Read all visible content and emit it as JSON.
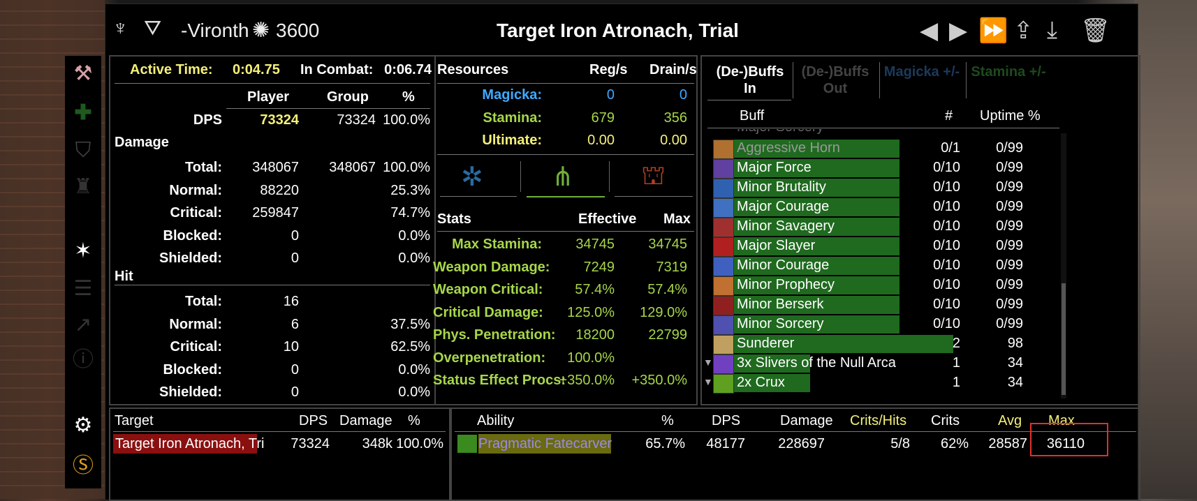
{
  "header": {
    "player_name": "-Vironth",
    "champion_points": "3600",
    "title": "Target Iron Atronach, Trial"
  },
  "summary": {
    "active_time_label": "Active Time:",
    "active_time": "0:04.75",
    "in_combat_label": "In Combat:",
    "in_combat": "0:06.74",
    "col_player": "Player",
    "col_group": "Group",
    "col_pct": "%",
    "dps_label": "DPS",
    "dps_player": "73324",
    "dps_group": "73324",
    "dps_pct": "100.0%",
    "damage_section": "Damage",
    "damage_rows": [
      {
        "label": "Total:",
        "player": "348067",
        "group": "348067",
        "pct": "100.0%"
      },
      {
        "label": "Normal:",
        "player": "88220",
        "group": "",
        "pct": "25.3%"
      },
      {
        "label": "Critical:",
        "player": "259847",
        "group": "",
        "pct": "74.7%"
      },
      {
        "label": "Blocked:",
        "player": "0",
        "group": "",
        "pct": "0.0%"
      },
      {
        "label": "Shielded:",
        "player": "0",
        "group": "",
        "pct": "0.0%"
      }
    ],
    "hit_section": "Hit",
    "hit_rows": [
      {
        "label": "Total:",
        "player": "16",
        "pct": ""
      },
      {
        "label": "Normal:",
        "player": "6",
        "pct": "37.5%"
      },
      {
        "label": "Critical:",
        "player": "10",
        "pct": "62.5%"
      },
      {
        "label": "Blocked:",
        "player": "0",
        "pct": "0.0%"
      },
      {
        "label": "Shielded:",
        "player": "0",
        "pct": "0.0%"
      }
    ]
  },
  "resources": {
    "header": "Resources",
    "col_reg": "Reg/s",
    "col_drain": "Drain/s",
    "rows": [
      {
        "label": "Magicka:",
        "reg": "0",
        "drain": "0",
        "color": "#3fa9ff"
      },
      {
        "label": "Stamina:",
        "reg": "679",
        "drain": "356",
        "color": "#a7d64a"
      },
      {
        "label": "Ultimate:",
        "reg": "0.00",
        "drain": "0.00",
        "color": "#f4f07a"
      }
    ]
  },
  "stats": {
    "header": "Stats",
    "col_effective": "Effective",
    "col_max": "Max",
    "rows": [
      {
        "label": "Max Stamina:",
        "eff": "34745",
        "max": "34745"
      },
      {
        "label": "Weapon Damage:",
        "eff": "7249",
        "max": "7319"
      },
      {
        "label": "Weapon Critical:",
        "eff": "57.4%",
        "max": "57.4%"
      },
      {
        "label": "Critical Damage:",
        "eff": "125.0%",
        "max": "129.0%"
      },
      {
        "label": "Phys. Penetration:",
        "eff": "18200",
        "max": "22799"
      },
      {
        "label": "Overpenetration:",
        "eff": "100.0%",
        "max": ""
      },
      {
        "label": "Status Effect Procs:",
        "eff": "+350.0%",
        "max": "+350.0%"
      }
    ]
  },
  "buffs": {
    "tabs": [
      "(De-)Buffs In",
      "(De-)Buffs Out",
      "Magicka +/-",
      "Stamina +/-"
    ],
    "col_buff": "Buff",
    "col_count": "#",
    "col_uptime": "Uptime %",
    "partial": "Major Sorcery",
    "rows": [
      {
        "name": "Aggressive Horn",
        "count": "0/1",
        "uptime": "0/99",
        "bar": 0.74,
        "dim": true,
        "icon_color": "#b07030"
      },
      {
        "name": "Major Force",
        "count": "0/10",
        "uptime": "0/99",
        "bar": 0.74,
        "icon_color": "#6040a0"
      },
      {
        "name": "Minor Brutality",
        "count": "0/10",
        "uptime": "0/99",
        "bar": 0.74,
        "icon_color": "#3060b0"
      },
      {
        "name": "Major Courage",
        "count": "0/10",
        "uptime": "0/99",
        "bar": 0.74,
        "icon_color": "#4070c0"
      },
      {
        "name": "Minor Savagery",
        "count": "0/10",
        "uptime": "0/99",
        "bar": 0.74,
        "icon_color": "#a03030"
      },
      {
        "name": "Major Slayer",
        "count": "0/10",
        "uptime": "0/99",
        "bar": 0.74,
        "icon_color": "#b02020"
      },
      {
        "name": "Minor Courage",
        "count": "0/10",
        "uptime": "0/99",
        "bar": 0.74,
        "icon_color": "#4060c0"
      },
      {
        "name": "Minor Prophecy",
        "count": "0/10",
        "uptime": "0/99",
        "bar": 0.74,
        "icon_color": "#c07030"
      },
      {
        "name": "Minor Berserk",
        "count": "0/10",
        "uptime": "0/99",
        "bar": 0.74,
        "icon_color": "#902020"
      },
      {
        "name": "Minor Sorcery",
        "count": "0/10",
        "uptime": "0/99",
        "bar": 0.74,
        "icon_color": "#5050b0"
      },
      {
        "name": "Sunderer",
        "count": "2",
        "uptime": "98",
        "bar": 0.98,
        "icon_color": "#c0a060"
      },
      {
        "name": "3x Slivers of the Null Arca",
        "count": "1",
        "uptime": "34",
        "bar": 0.34,
        "expand": true,
        "icon_color": "#7040c0"
      },
      {
        "name": "2x Crux",
        "count": "1",
        "uptime": "34",
        "bar": 0.34,
        "expand": true,
        "icon_color": "#60a020"
      }
    ]
  },
  "target_table": {
    "col_target": "Target",
    "col_dps": "DPS",
    "col_damage": "Damage",
    "col_pct": "%",
    "row": {
      "target": "Target Iron Atronach, Tri",
      "dps": "73324",
      "damage": "348k",
      "pct": "100.0%"
    }
  },
  "ability_table": {
    "cols": [
      "Ability",
      "%",
      "DPS",
      "Damage",
      "Crits/Hits",
      "Crits",
      "Avg",
      "Max"
    ],
    "row": {
      "ability": "Pragmatic Fatecarver",
      "pct": "65.7%",
      "dps": "48177",
      "damage": "228697",
      "crits_hits": "5/8",
      "crits": "62%",
      "avg": "28587",
      "max": "36110"
    }
  }
}
